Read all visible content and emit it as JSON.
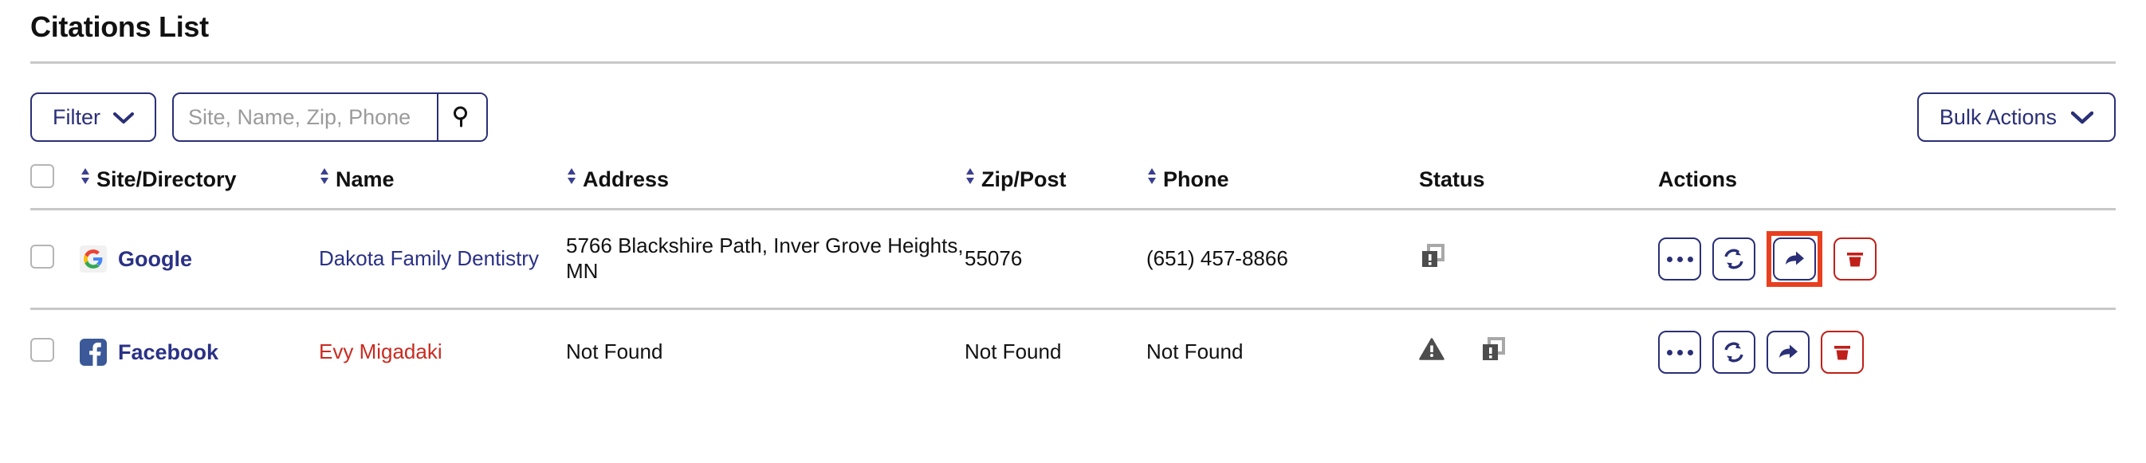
{
  "header": {
    "title": "Citations List"
  },
  "toolbar": {
    "filter_label": "Filter",
    "search_placeholder": "Site, Name, Zip, Phone",
    "search_value": "",
    "search_icon": "search-icon",
    "bulk_actions_label": "Bulk Actions",
    "chevron_icon": "chevron-down-icon"
  },
  "table": {
    "columns": [
      {
        "label": "",
        "sortable": false,
        "key": "select"
      },
      {
        "label": "Site/Directory",
        "sortable": true,
        "key": "site"
      },
      {
        "label": "Name",
        "sortable": true,
        "key": "name"
      },
      {
        "label": "Address",
        "sortable": true,
        "key": "address"
      },
      {
        "label": "Zip/Post",
        "sortable": true,
        "key": "zip"
      },
      {
        "label": "Phone",
        "sortable": true,
        "key": "phone"
      },
      {
        "label": "Status",
        "sortable": false,
        "key": "status"
      },
      {
        "label": "Actions",
        "sortable": false,
        "key": "actions"
      }
    ],
    "rows": [
      {
        "selected": false,
        "site": "Google",
        "site_icon": "google-logo-icon",
        "name": "Dakota Family Dentistry",
        "name_state": "link",
        "address": "5766 Blackshire Path, Inver Grove Heights, MN",
        "zip": "55076",
        "phone": "(651) 457-8866",
        "status_icons": [
          "duplicate-alert-icon"
        ],
        "actions": [
          "more-icon",
          "sync-icon",
          "forward-icon",
          "delete-icon"
        ],
        "highlighted_action": "forward-icon"
      },
      {
        "selected": false,
        "site": "Facebook",
        "site_icon": "facebook-logo-icon",
        "name": "Evy Migadaki",
        "name_state": "alert",
        "address": "Not Found",
        "zip": "Not Found",
        "phone": "Not Found",
        "status_icons": [
          "warning-triangle-icon",
          "duplicate-alert-icon"
        ],
        "actions": [
          "more-icon",
          "sync-icon",
          "forward-icon",
          "delete-icon"
        ],
        "highlighted_action": ""
      }
    ]
  },
  "colors": {
    "navy": "#2a2f77",
    "link_navy": "#2a3185",
    "danger_red": "#c0201a",
    "alert_red": "#c92b20",
    "highlight_orange": "#e8401f",
    "rule_gray": "#c8c8c8",
    "status_gray": "#4d4d4d"
  }
}
